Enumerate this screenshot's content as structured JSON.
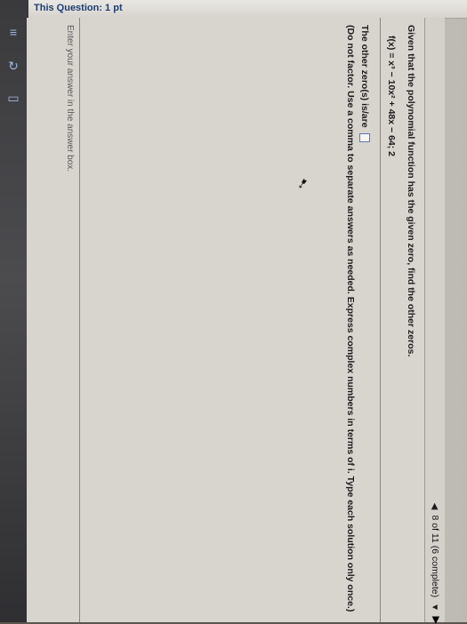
{
  "header": {
    "title": "This Question: 1 pt"
  },
  "nav": {
    "prev_icon": "triangle-left-icon",
    "progress": "8 of 11 (6 complete)",
    "dropdown_icon": "triangle-down-icon",
    "next_icon": "triangle-right-icon"
  },
  "question": {
    "prompt": "Given that the polynomial function has the given zero, find the other zeros.",
    "function": "f(x) = x³ − 10x² + 48x − 64; 2",
    "answer_prefix": "The other zero(s) is/are",
    "instructions": "(Do not factor. Use a comma to separate answers as needed. Express complex numbers in terms of i. Type each solution only once.)"
  },
  "footer": {
    "hint": "Enter your answer in the answer box."
  },
  "cursor_icon": "mouse-pointer-icon"
}
